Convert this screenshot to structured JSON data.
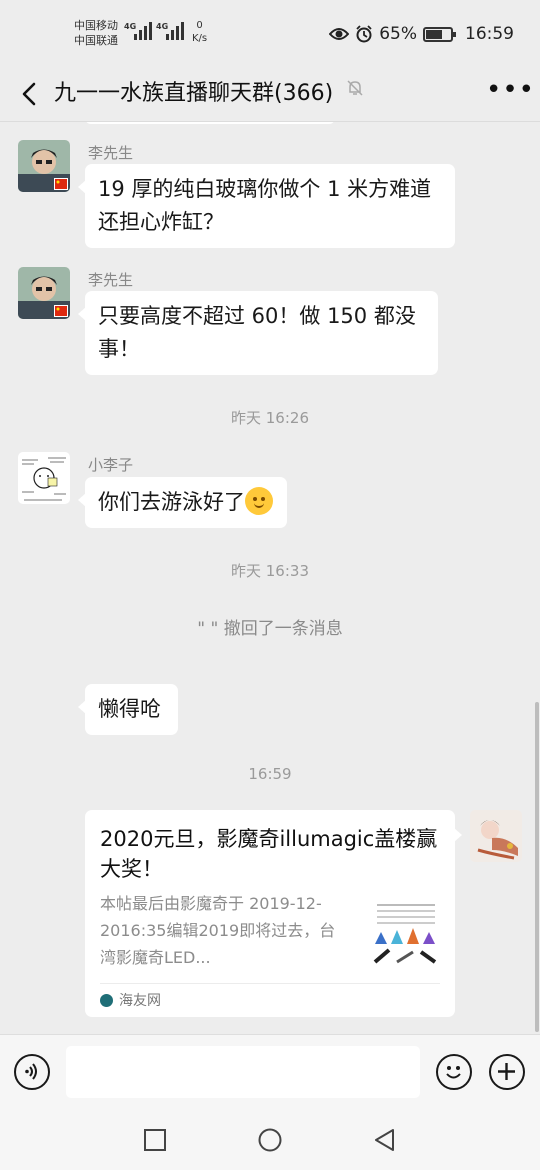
{
  "status_bar": {
    "carrier_1": "中国移动",
    "carrier_2": "中国联通",
    "network_1": "4G",
    "network_2": "4G",
    "speed_value": "0",
    "speed_unit": "K/s",
    "battery": "65%",
    "time": "16:59",
    "icons": [
      "eye-icon",
      "alarm-icon",
      "battery-icon"
    ]
  },
  "header": {
    "title": "九一一水族直播聊天群(366)",
    "icons": [
      "back-arrow-icon",
      "mute-bell-icon",
      "more-dots-icon"
    ]
  },
  "messages": [
    {
      "sender": "李先生",
      "text": "19 厚的纯白玻璃你做个 1 米方难道还担心炸缸？"
    },
    {
      "sender": "李先生",
      "text": "只要高度不超过 60！做 150 都没事！"
    },
    {
      "time": "昨天 16:26"
    },
    {
      "sender": "小李子",
      "text": "你们去游泳好了"
    },
    {
      "time": "昨天 16:33"
    },
    {
      "recall": "\" \" 撤回了一条消息"
    },
    {
      "text": "懒得呛"
    },
    {
      "time": "16:59"
    }
  ],
  "link_card": {
    "title": "2020元旦，影魔奇illumagic盖楼赢大奖！",
    "description": "本帖最后由影魔奇于 2019-12-2016:35编辑2019即将过去，台湾影魔奇LED...",
    "source": "海友网"
  },
  "input_bar": {
    "placeholder": "",
    "icons": [
      "voice-icon",
      "emoji-icon",
      "plus-icon"
    ]
  },
  "nav_bar": {
    "icons": [
      "recent-apps-icon",
      "home-icon",
      "back-icon"
    ]
  },
  "colors": {
    "background": "#ededed",
    "bubble": "#ffffff",
    "meta_text": "#9a9a9a"
  }
}
